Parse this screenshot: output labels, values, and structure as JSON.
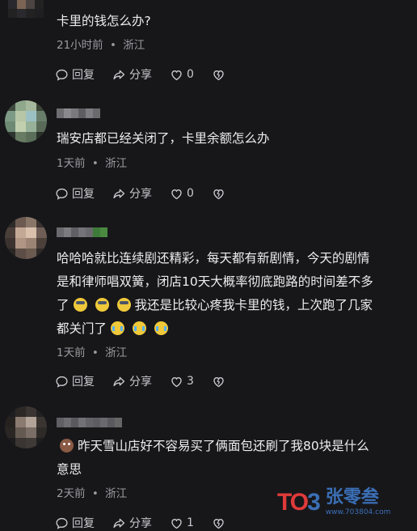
{
  "comments": [
    {
      "text": "卡里的钱怎么办?",
      "time": "21小时前",
      "location": "浙江",
      "reply_label": "回复",
      "share_label": "分享",
      "likes": "0"
    },
    {
      "text": "瑞安店都已经关闭了，卡里余额怎么办",
      "time": "1天前",
      "location": "浙江",
      "reply_label": "回复",
      "share_label": "分享",
      "likes": "0"
    },
    {
      "text_line1": "哈哈哈就比连续剧还精彩，每天都有新剧情，今天的剧情",
      "text_line2": "是和律师唱双簧，闭店10天大概率彻底跑路的时间差不多",
      "text_line3_a": "了",
      "text_line3_b": "我还是比较心疼我卡里的钱，上次跑了几家",
      "text_line4": "都关门了",
      "time": "1天前",
      "location": "浙江",
      "reply_label": "回复",
      "share_label": "分享",
      "likes": "3"
    },
    {
      "text_line1": "昨天雪山店好不容易买了俩面包还刷了我80块是什么",
      "text_line2": "意思",
      "time": "2天前",
      "location": "浙江",
      "reply_label": "回复",
      "share_label": "分享",
      "likes": "1"
    }
  ],
  "separator": "•",
  "icons": [
    "reply-icon",
    "share-icon",
    "like-heart-icon",
    "dislike-heart-icon"
  ],
  "watermark": {
    "logo_a": "TO",
    "logo_b": "3",
    "name": "张零叁",
    "url": "www.703804.com"
  }
}
